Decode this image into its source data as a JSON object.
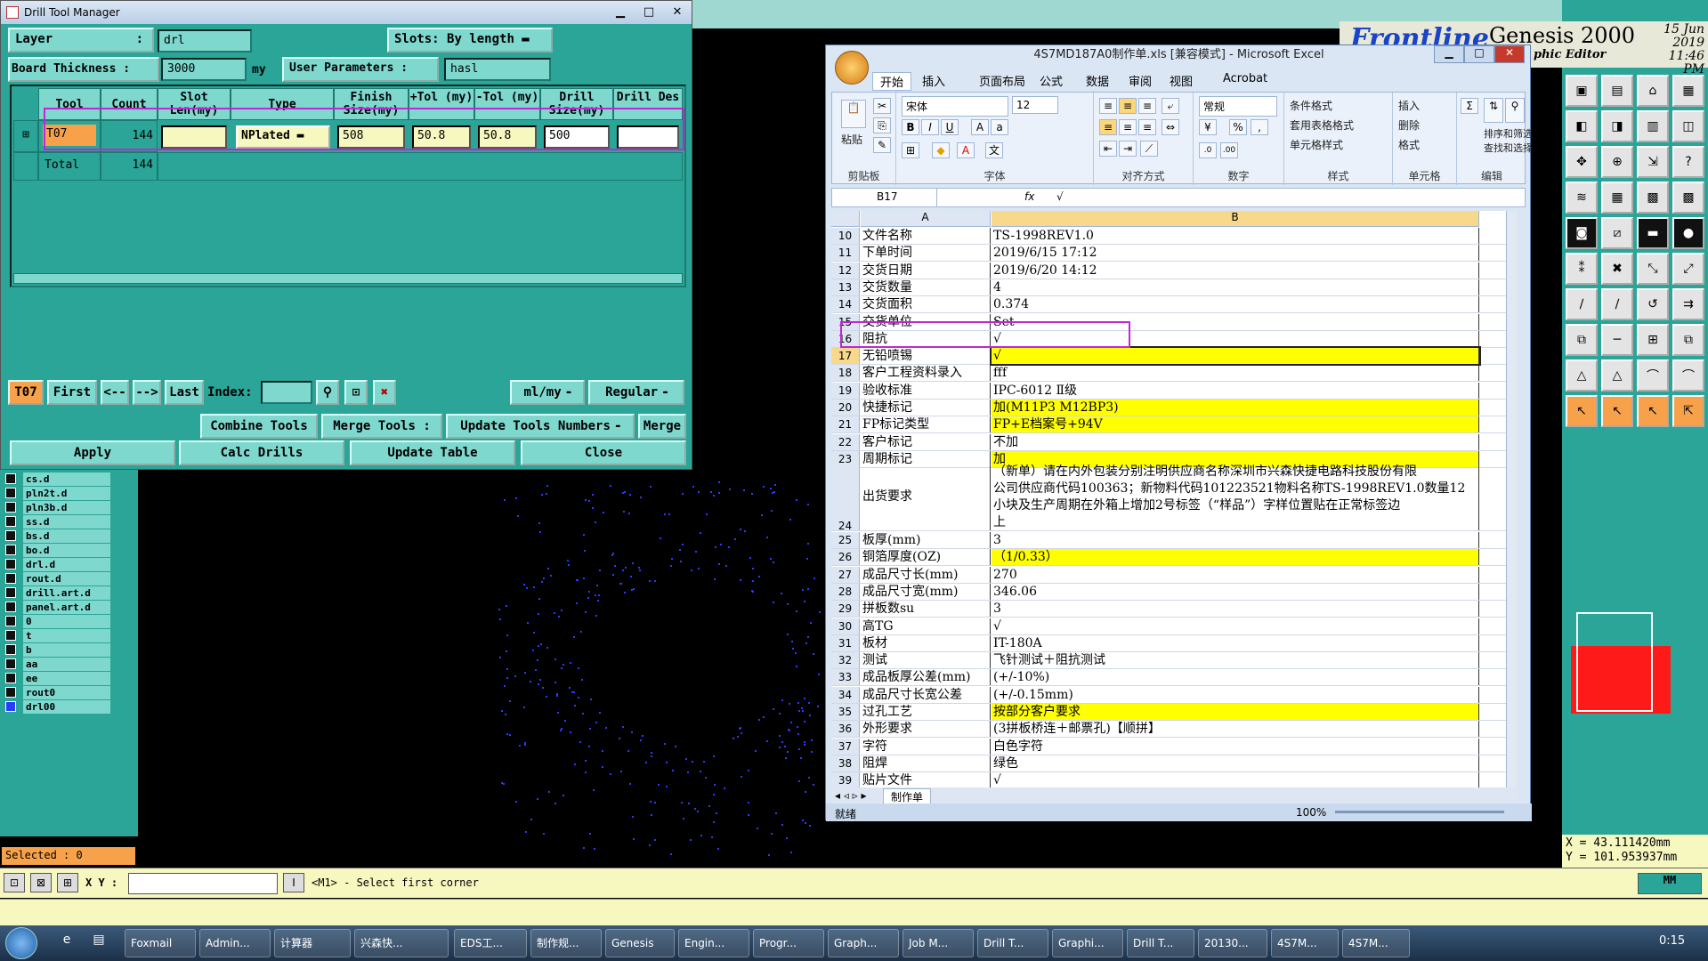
{
  "drill_window": {
    "title": "Drill Tool Manager",
    "layer_label": "Layer",
    "layer_value": "drl",
    "slots_label": "Slots:",
    "slots_value": "By length",
    "board_thickness_label": "Board Thickness :",
    "board_thickness_value": "3000",
    "board_thickness_unit": "my",
    "user_params_label": "User Parameters :",
    "user_params_value": "hasl",
    "columns": [
      "Tool",
      "Count",
      "Slot Len(my)",
      "Type",
      "Finish Size(my)",
      "+Tol (my)",
      "-Tol (my)",
      "Drill Size(my)",
      "Drill Des"
    ],
    "rows": [
      {
        "tool": "T07",
        "count": "144",
        "slot_len": "",
        "type": "NPlated",
        "finish": "508",
        "ptol": "50.8",
        "ntol": "50.8",
        "drill": "500",
        "des": ""
      }
    ],
    "total_label": "Total",
    "total_count": "144",
    "current_tool": "T07",
    "nav": {
      "first": "First",
      "prev": "<--",
      "next": "-->",
      "last": "Last",
      "index_label": "Index:"
    },
    "units": "ml/my",
    "mode": "Regular",
    "buttons": {
      "combine": "Combine Tools",
      "merge_tools": "Merge Tools :",
      "update_numbers": "Update Tools Numbers",
      "merge": "Merge",
      "apply": "Apply",
      "calc": "Calc Drills",
      "update_table": "Update Table",
      "close": "Close"
    }
  },
  "layers": [
    "cs.d",
    "pln2t.d",
    "pln3b.d",
    "ss.d",
    "bs.d",
    "bo.d",
    "drl.d",
    "rout.d",
    "drill.art.d",
    "panel.art.d",
    "0",
    "t",
    "b",
    "aa",
    "ee",
    "rout0",
    "drl00"
  ],
  "selected_text": "Selected : 0",
  "status": {
    "xy_label": "X Y :",
    "message": "<M1> - Select first corner",
    "unit": "MM"
  },
  "genesis": {
    "logo": "Frontline",
    "app": "Genesis 2000",
    "date": "15 Jun 2019",
    "time": "11:46 PM",
    "editor": "phic Editor"
  },
  "coords": {
    "x": "X = 43.111420mm",
    "y": "Y = 101.953937mm"
  },
  "excel": {
    "title": "4S7MD187A0制作单.xls  [兼容模式] - Microsoft Excel",
    "tabs": [
      "开始",
      "插入",
      "页面布局",
      "公式",
      "数据",
      "审阅",
      "视图",
      "Acrobat"
    ],
    "font_name": "宋体",
    "font_size": "12",
    "number_format": "常规",
    "groups": [
      "剪贴板",
      "字体",
      "对齐方式",
      "数字",
      "样式",
      "单元格",
      "编辑"
    ],
    "ribbon_items": {
      "paste": "粘贴",
      "cond_format": "条件格式",
      "table_format": "套用表格格式",
      "cell_style": "单元格样式",
      "insert": "插入",
      "delete": "删除",
      "format": "格式",
      "sort": "排序和筛选",
      "find": "查找和选择"
    },
    "name_box": "B17",
    "formula": "√",
    "col_a": "A",
    "col_b": "B",
    "rows": [
      {
        "n": "10",
        "a": "文件名称",
        "b": "TS-1998REV1.0",
        "y": false
      },
      {
        "n": "11",
        "a": "下单时间",
        "b": "2019/6/15 17:12",
        "y": false
      },
      {
        "n": "12",
        "a": "交货日期",
        "b": "2019/6/20 14:12",
        "y": false
      },
      {
        "n": "13",
        "a": "交货数量",
        "b": "4",
        "y": false
      },
      {
        "n": "14",
        "a": "交货面积",
        "b": "0.374",
        "y": false
      },
      {
        "n": "15",
        "a": "交货单位",
        "b": "Set",
        "y": false
      },
      {
        "n": "16",
        "a": "阻抗",
        "b": "√",
        "y": false
      },
      {
        "n": "17",
        "a": "无铅喷锡",
        "b": "√",
        "y": true
      },
      {
        "n": "18",
        "a": "客户工程资料录入",
        "b": "fff",
        "y": false
      },
      {
        "n": "19",
        "a": "验收标准",
        "b": "IPC-6012 Ⅱ级",
        "y": false
      },
      {
        "n": "20",
        "a": "快捷标记",
        "b": "加(M11P3 M12BP3)",
        "y": true
      },
      {
        "n": "21",
        "a": "FP标记类型",
        "b": "FP+E档案号+94V",
        "y": true
      },
      {
        "n": "22",
        "a": "客户标记",
        "b": "不加",
        "y": false
      },
      {
        "n": "23",
        "a": "周期标记",
        "b": "加",
        "y": true
      }
    ],
    "row24": {
      "n": "24",
      "a": "出货要求",
      "lines": [
        "（新单）请在内外包装分别注明供应商名称深圳市兴森快捷电路科技股份有限",
        "公司供应商代码100363；新物料代码101223521物料名称TS-1998REV1.0数量12",
        "小块及生产周期在外箱上增加2号标签（“样品”）字样位置贴在正常标签边",
        "上"
      ]
    },
    "rows2": [
      {
        "n": "25",
        "a": "板厚(mm)",
        "b": "3",
        "y": false
      },
      {
        "n": "26",
        "a": "铜箔厚度(OZ)",
        "b": "（1/0.33）",
        "y": true
      },
      {
        "n": "27",
        "a": "成品尺寸长(mm)",
        "b": "270",
        "y": false
      },
      {
        "n": "28",
        "a": "成品尺寸宽(mm)",
        "b": "346.06",
        "y": false
      },
      {
        "n": "29",
        "a": "拼板数su",
        "b": "3",
        "y": false
      },
      {
        "n": "30",
        "a": "高TG",
        "b": "√",
        "y": false
      },
      {
        "n": "31",
        "a": "板材",
        "b": "IT-180A",
        "y": false
      },
      {
        "n": "32",
        "a": "测试",
        "b": "飞针测试＋阻抗测试",
        "y": false
      },
      {
        "n": "33",
        "a": "成品板厚公差(mm)",
        "b": "(+/-10%)",
        "y": false
      },
      {
        "n": "34",
        "a": "成品尺寸长宽公差",
        "b": "(+/-0.15mm)",
        "y": false
      },
      {
        "n": "35",
        "a": "过孔工艺",
        "b": "按部分客户要求",
        "y": true
      },
      {
        "n": "36",
        "a": "外形要求",
        "b": "(3拼板桥连＋邮票孔)【顺拼】",
        "y": false
      },
      {
        "n": "37",
        "a": "字符",
        "b": "白色字符",
        "y": false
      },
      {
        "n": "38",
        "a": "阻焊",
        "b": "绿色",
        "y": false
      },
      {
        "n": "39",
        "a": "贴片文件",
        "b": "√",
        "y": false
      }
    ],
    "sheet_tab": "制作单",
    "status_ready": "就绪",
    "zoom": "100%"
  },
  "taskbar": {
    "items": [
      "Foxmail",
      "Admin...",
      "计算器",
      "兴森快...",
      "EDS工...",
      "制作规...",
      "Genesis",
      "Engin...",
      "Progr...",
      "Graph...",
      "Job M...",
      "Drill T...",
      "Graphi...",
      "Drill T...",
      "20130...",
      "4S7M...",
      "4S7M..."
    ],
    "time": "0:15"
  }
}
